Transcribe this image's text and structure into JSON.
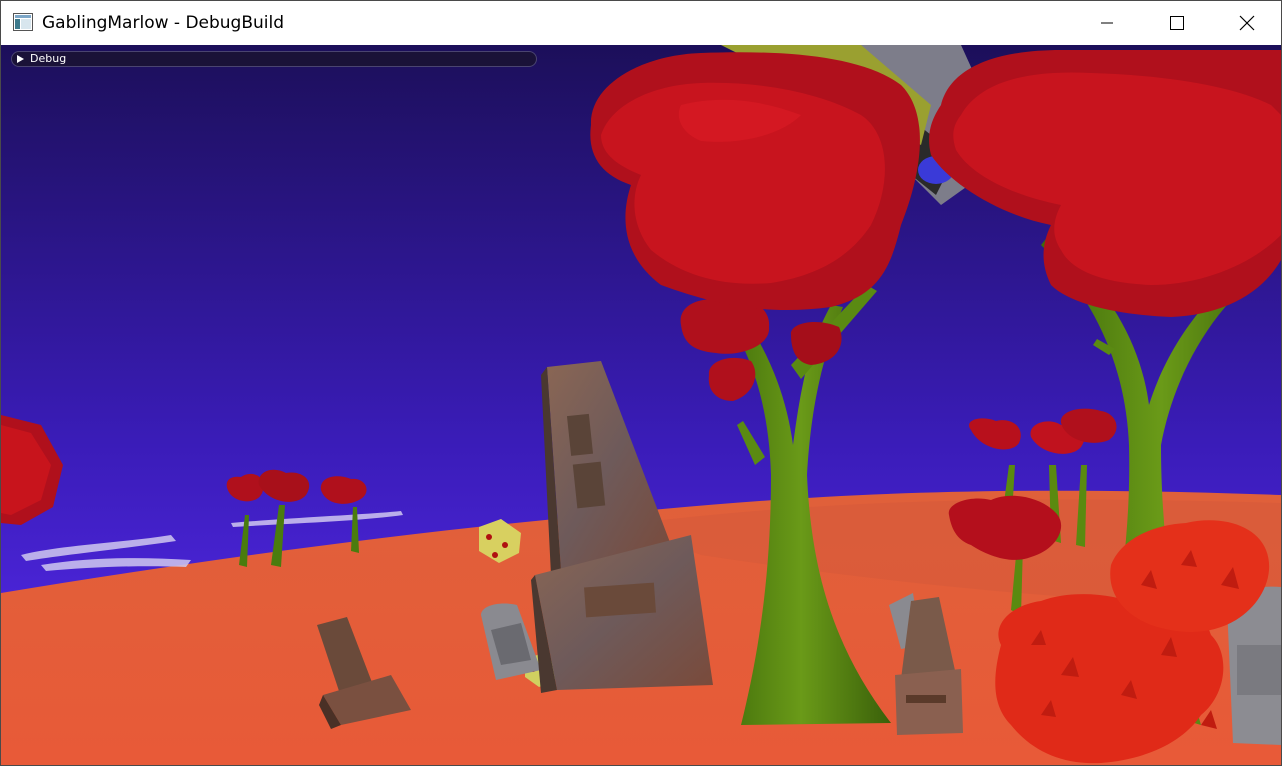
{
  "window": {
    "title": "GablingMarlow - DebugBuild",
    "icon": "app-window-icon",
    "controls": {
      "minimize_icon": "minimize-icon",
      "maximize_icon": "maximize-icon",
      "close_icon": "close-icon"
    }
  },
  "debug_panel": {
    "label": "Debug",
    "collapsed": true,
    "toggle_icon": "triangle-right-icon"
  },
  "scene": {
    "description_colors": {
      "sky_top": "#1c0f5a",
      "sky_bottom": "#5a2cf0",
      "ground": "#e2603e",
      "foliage": "#b0101c",
      "trunk": "#5a8a10",
      "bush": "#e0281a",
      "stone": "#7a5a4a"
    }
  }
}
